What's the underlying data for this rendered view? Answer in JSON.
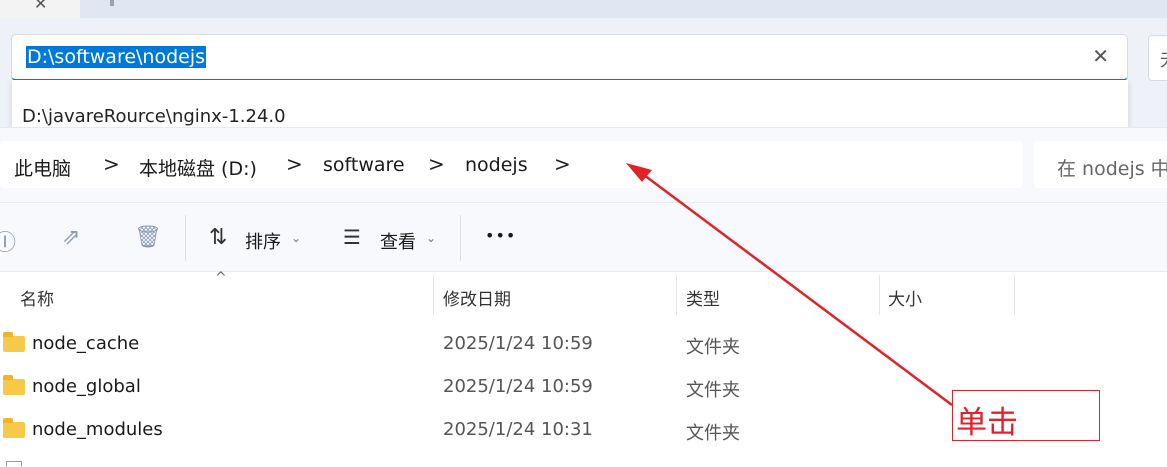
{
  "window": {
    "tab_close_icon": "close-icon"
  },
  "address_bar": {
    "value": "D:\\software\\nodejs",
    "clear_icon": "close-icon",
    "right_box_glyph": "无"
  },
  "suggestion": {
    "text": "D:\\javareRource\\nginx-1.24.0"
  },
  "breadcrumb": {
    "items": [
      "此电脑",
      "本地磁盘 (D:)",
      "software",
      "nodejs"
    ],
    "separator": ">"
  },
  "search": {
    "placeholder": "在 nodejs 中"
  },
  "toolbar": {
    "sort_label": "排序",
    "view_label": "查看",
    "more_label": "•••"
  },
  "columns": {
    "name": "名称",
    "modified": "修改日期",
    "type": "类型",
    "size": "大小"
  },
  "rows": [
    {
      "name": "node_cache",
      "modified": "2025/1/24 10:59",
      "type": "文件夹"
    },
    {
      "name": "node_global",
      "modified": "2025/1/24 10:59",
      "type": "文件夹"
    },
    {
      "name": "node_modules",
      "modified": "2025/1/24 10:31",
      "type": "文件夹"
    }
  ],
  "annotation": {
    "text": "单击",
    "color": "#e0232a"
  },
  "colors": {
    "selection": "#0078d7",
    "accent_underline": "#1f6fd6",
    "folder": "#f7c948"
  }
}
